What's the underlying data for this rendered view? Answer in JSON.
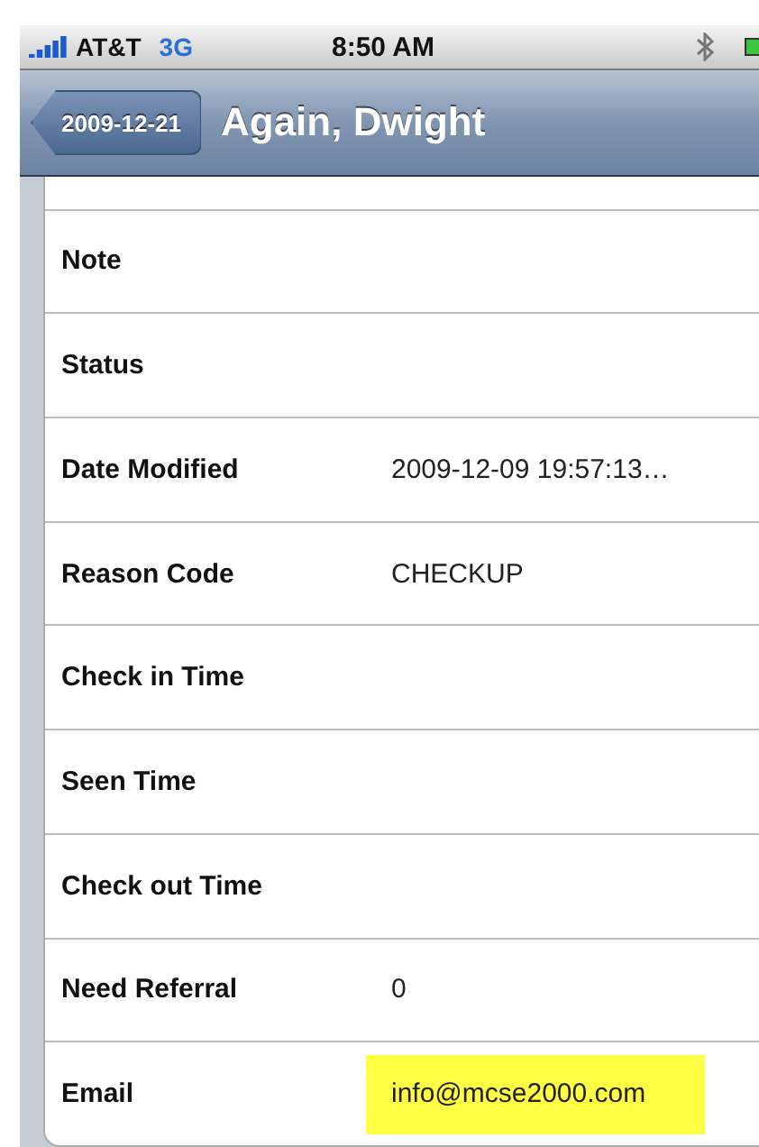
{
  "status_bar": {
    "carrier": "AT&T",
    "network": "3G",
    "time": "8:50 AM"
  },
  "nav_bar": {
    "back_button": "2009-12-21",
    "title": "Again, Dwight"
  },
  "rows": [
    {
      "label": "Note",
      "highlighted": false
    },
    {
      "label": "Status",
      "highlighted": false
    },
    {
      "label": "Date Modified",
      "value": "2009-12-09 19:57:13…",
      "highlighted": false
    },
    {
      "label": "Reason Code",
      "value": "CHECKUP",
      "highlighted": false
    },
    {
      "label": "Check in Time",
      "highlighted": false
    },
    {
      "label": "Seen Time",
      "highlighted": false
    },
    {
      "label": "Check out Time",
      "highlighted": false
    },
    {
      "label": "Need Referral",
      "value": "0",
      "highlighted": false
    },
    {
      "label": "Email",
      "value": "info@mcse2000.com",
      "highlighted": true
    }
  ]
}
